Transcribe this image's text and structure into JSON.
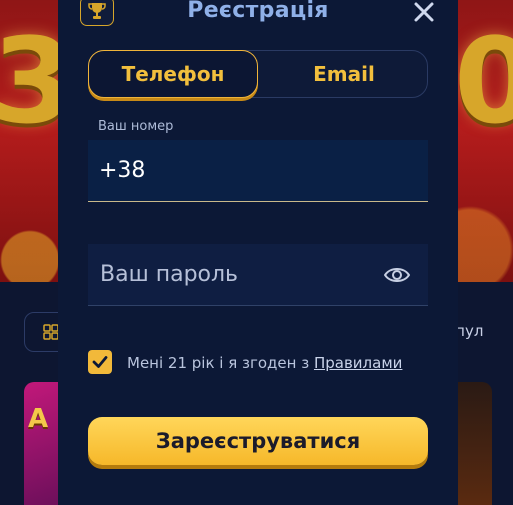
{
  "background": {
    "digit_left": "3",
    "digit_right": "0",
    "side_text": "опул",
    "tile_letter": "A"
  },
  "modal": {
    "title": "Реєстрація",
    "tabs": [
      {
        "label": "Телефон",
        "active": true
      },
      {
        "label": "Email",
        "active": false
      }
    ],
    "phone": {
      "label": "Ваш номер",
      "value": "+38"
    },
    "password": {
      "placeholder": "Ваш пароль"
    },
    "agreement": {
      "checked": true,
      "text": "Мені 21 рік і я згоден з ",
      "link": "Правилами"
    },
    "submit_label": "Зареєструватися"
  },
  "colors": {
    "accent": "#f2b93a",
    "modal_bg": "#0c1836",
    "title": "#8fb0e8"
  },
  "icons": [
    "trophy-icon",
    "close-icon",
    "eye-icon",
    "checkmark-icon",
    "grid-icon"
  ]
}
